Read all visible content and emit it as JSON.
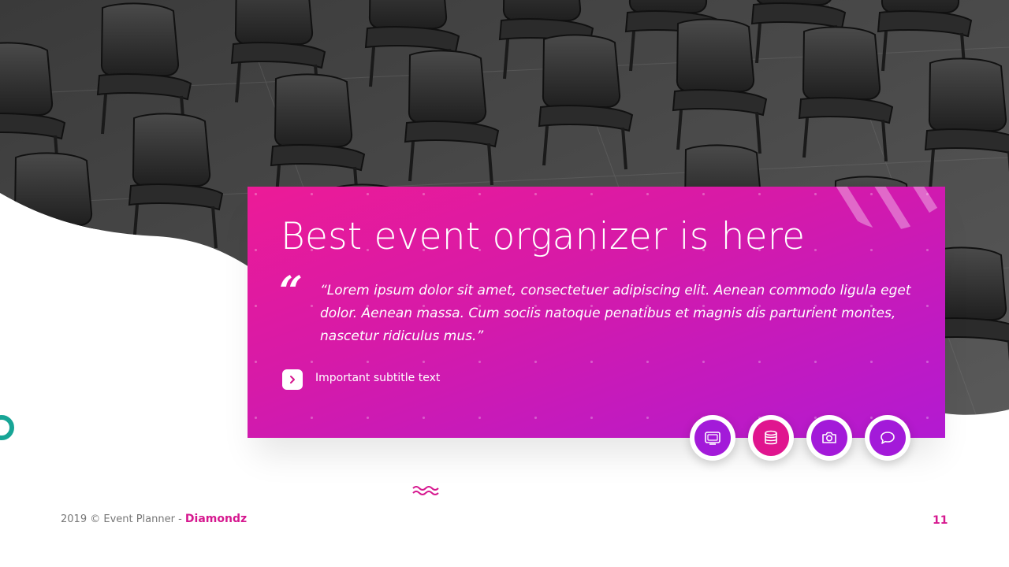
{
  "slide": {
    "title": "Best event organizer is here",
    "quote_mark": "“",
    "quote": "“Lorem ipsum dolor sit amet, consectetuer adipiscing elit. Aenean commodo ligula eget dolor. Aenean massa. Cum sociis natoque penatibus et magnis dis parturient montes, nascetur ridiculus mus.”",
    "subtitle": "Important subtitle text",
    "icons": [
      {
        "name": "tv-icon",
        "color": "#a31ad9"
      },
      {
        "name": "database-icon",
        "color": "#e0158f"
      },
      {
        "name": "camera-icon",
        "color": "#a31ad9"
      },
      {
        "name": "chat-icon",
        "color": "#a31ad9"
      }
    ]
  },
  "footer": {
    "prefix": "2019 © Event Planner - ",
    "brand": "Diamondz",
    "page": "11"
  },
  "colors": {
    "accent_pink": "#ec1b97",
    "accent_purple": "#b21ad2",
    "teal": "#17a596",
    "brand_text": "#d6188f"
  }
}
